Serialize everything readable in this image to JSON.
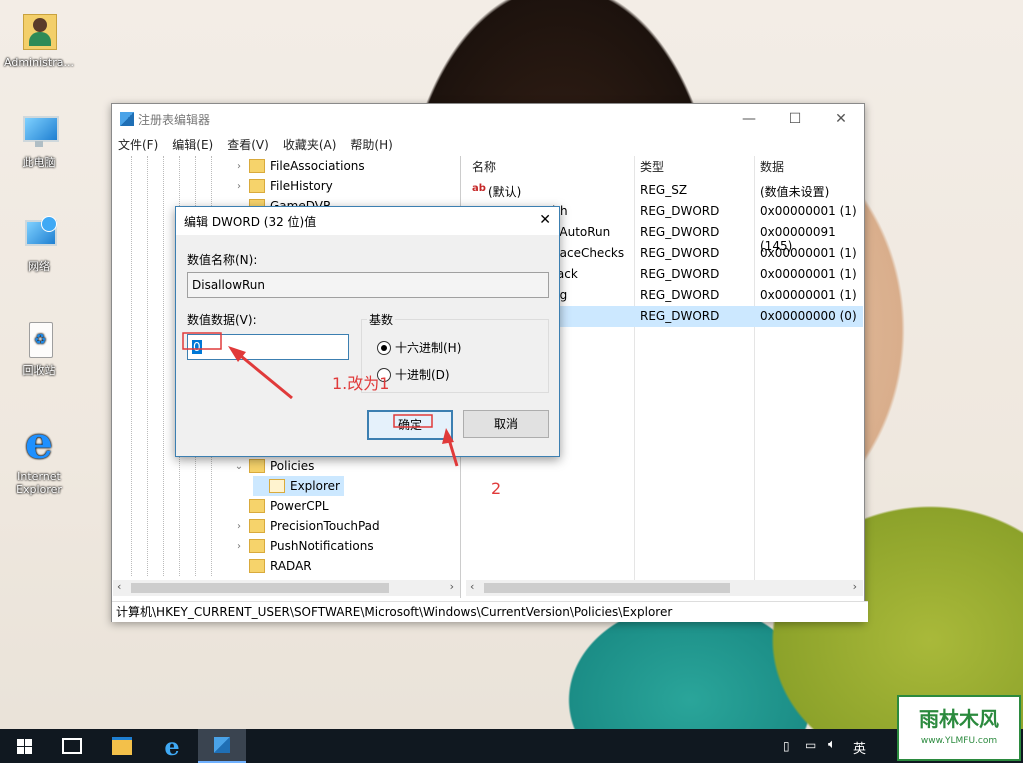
{
  "desktop": {
    "icons": [
      {
        "label": "Administra..."
      },
      {
        "label": "此电脑"
      },
      {
        "label": "网络"
      },
      {
        "label": "回收站"
      },
      {
        "label": "Internet Explorer"
      }
    ]
  },
  "window": {
    "title": "注册表编辑器",
    "menu": [
      "文件(F)",
      "编辑(E)",
      "查看(V)",
      "收藏夹(A)",
      "帮助(H)"
    ],
    "tree": [
      {
        "label": "FileAssociations",
        "expand": "›"
      },
      {
        "label": "FileHistory",
        "expand": "›"
      },
      {
        "label": "GameDVR",
        "expand": ""
      },
      {
        "label": "Policies",
        "expand": "⌄"
      },
      {
        "label": "Explorer",
        "expand": ""
      },
      {
        "label": "PowerCPL",
        "expand": ""
      },
      {
        "label": "PrecisionTouchPad",
        "expand": "›"
      },
      {
        "label": "PushNotifications",
        "expand": "›"
      },
      {
        "label": "RADAR",
        "expand": ""
      }
    ],
    "list_headers": {
      "name": "名称",
      "type": "类型",
      "data": "数据"
    },
    "list_rows": [
      {
        "name": "(默认)",
        "type": "REG_SZ",
        "data": "(数值未设置)"
      },
      {
        "name": "lth",
        "type": "REG_DWORD",
        "data": "0x00000001 (1)"
      },
      {
        "name": "eAutoRun",
        "type": "REG_DWORD",
        "data": "0x00000091 (145)"
      },
      {
        "name": "paceChecks",
        "type": "REG_DWORD",
        "data": "0x00000001 (1)"
      },
      {
        "name": "rack",
        "type": "REG_DWORD",
        "data": "0x00000001 (1)"
      },
      {
        "name": "ng",
        "type": "REG_DWORD",
        "data": "0x00000001 (1)"
      },
      {
        "name": "",
        "type": "REG_DWORD",
        "data": "0x00000000 (0)"
      }
    ],
    "status_path": "计算机\\HKEY_CURRENT_USER\\SOFTWARE\\Microsoft\\Windows\\CurrentVersion\\Policies\\Explorer"
  },
  "dialog": {
    "title": "编辑 DWORD (32 位)值",
    "name_label": "数值名称(N):",
    "name_value": "DisallowRun",
    "data_label": "数值数据(V):",
    "data_value": "0",
    "base_label": "基数",
    "hex_label": "十六进制(H)",
    "dec_label": "十进制(D)",
    "ok_label": "确定",
    "cancel_label": "取消"
  },
  "annotations": {
    "step1": "1.改为1",
    "step2": "2"
  },
  "taskbar": {
    "ime": "英",
    "watermark": "雨林木风",
    "watermark_url": "www.YLMFU.com"
  },
  "colors": {
    "accent": "#3c7fb1",
    "selection": "#cce8ff",
    "annotation": "#e03a3a",
    "taskbar": "#101820"
  }
}
